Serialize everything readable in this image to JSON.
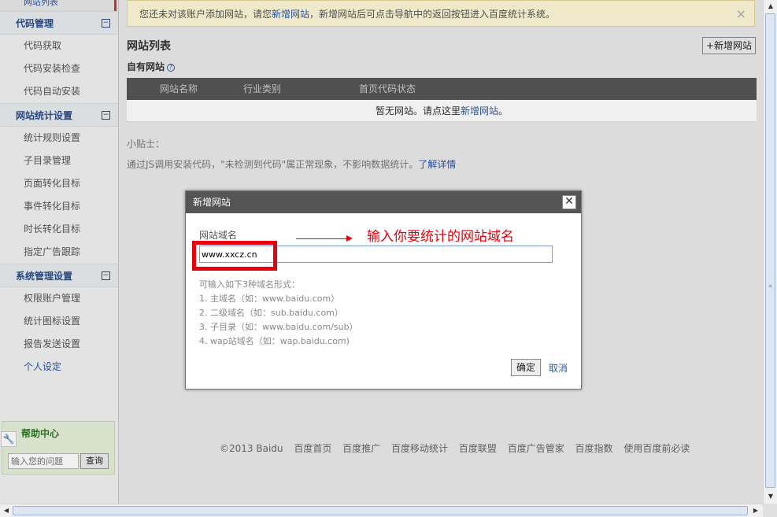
{
  "sidebar": {
    "top_cut_label": "网站列表",
    "sections": [
      {
        "title": "代码管理",
        "toggle": "−",
        "items": [
          "代码获取",
          "代码安装检查",
          "代码自动安装"
        ]
      },
      {
        "title": "网站统计设置",
        "toggle": "−",
        "items": [
          "统计规则设置",
          "子目录管理",
          "页面转化目标",
          "事件转化目标",
          "时长转化目标",
          "指定广告跟踪"
        ]
      },
      {
        "title": "系统管理设置",
        "toggle": "−",
        "items": [
          "权限账户管理",
          "统计图标设置",
          "报告发送设置",
          "个人设定"
        ]
      }
    ],
    "help": {
      "title": "帮助中心",
      "input_placeholder": "输入您的问题",
      "search_button": "查询"
    }
  },
  "notice": {
    "part1": "您还未对该账户添加网站，请您",
    "link": "新增网站",
    "part2": "，新增网站后可点击导航中的返回按钮进入百度统计系统。",
    "close": "×"
  },
  "main": {
    "title": "网站列表",
    "add_button": "+新增网站",
    "own_sites": "自有网站",
    "help_q": "?",
    "columns": [
      "网站名称",
      "行业类别",
      "首页代码状态"
    ],
    "empty_part1": "暂无网站。请点这里",
    "empty_link": "新增网站",
    "empty_part2": "。",
    "tip_title": "小贴士：",
    "tip_text": "通过JS调用安装代码，\"未检测到代码\"属正常现象，不影响数据统计。",
    "tip_link": "了解详情"
  },
  "dialog": {
    "title": "新增网站",
    "close": "✕",
    "field_label": "网站域名",
    "field_value": "www.xxcz.cn",
    "annotation": "输入你要统计的网站域名",
    "formats_title": "可输入如下3种域名形式：",
    "formats": [
      "1. 主域名（如：www.baidu.com）",
      "2. 二级域名（如：sub.baidu.com）",
      "3. 子目录（如：www.baidu.com/sub）",
      "4. wap站域名（如：wap.baidu.com)"
    ],
    "ok": "确定",
    "cancel": "取消"
  },
  "footer": [
    "©2013 Baidu",
    "百度首页",
    "百度推广",
    "百度移动统计",
    "百度联盟",
    "百度广告管家",
    "百度指数",
    "使用百度前必读"
  ],
  "colors": {
    "accent_blue": "#2b57a6",
    "annotation_red": "#e8000d",
    "header_gray": "#555555",
    "notice_bg": "#fff8d6"
  }
}
